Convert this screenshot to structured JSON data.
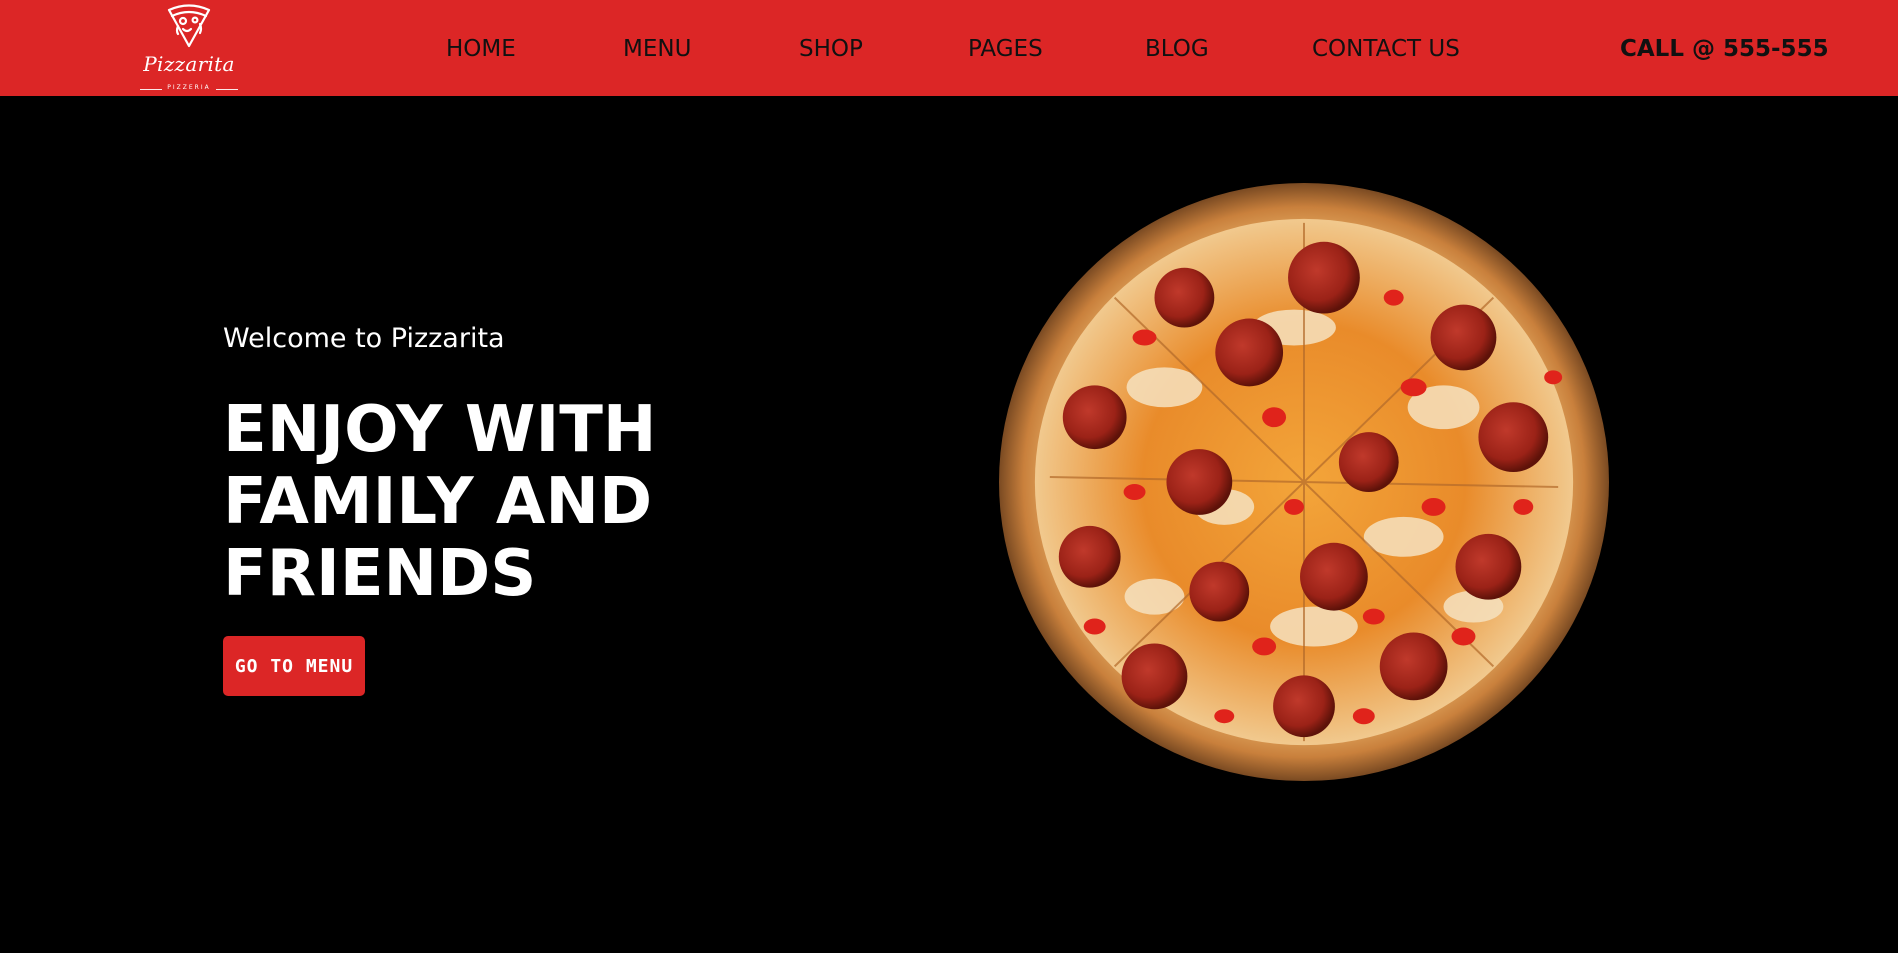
{
  "header": {
    "logo": {
      "name": "Pizzarita",
      "tagline": "PIZZERIA"
    },
    "nav": [
      {
        "label": "HOME"
      },
      {
        "label": "MENU"
      },
      {
        "label": "SHOP"
      },
      {
        "label": "PAGES"
      },
      {
        "label": "BLOG"
      },
      {
        "label": "CONTACT US"
      }
    ],
    "call": "CALL @ 555-555"
  },
  "hero": {
    "welcome": "Welcome to Pizzarita",
    "headline_lines": [
      "ENJOY WITH",
      "FAMILY AND",
      "FRIENDS"
    ],
    "cta_label": "GO TO MENU",
    "image": "pepperoni-pizza"
  },
  "colors": {
    "brand_red": "#dc2626",
    "background": "#000000",
    "nav_text": "#111111",
    "hero_text": "#ffffff"
  }
}
